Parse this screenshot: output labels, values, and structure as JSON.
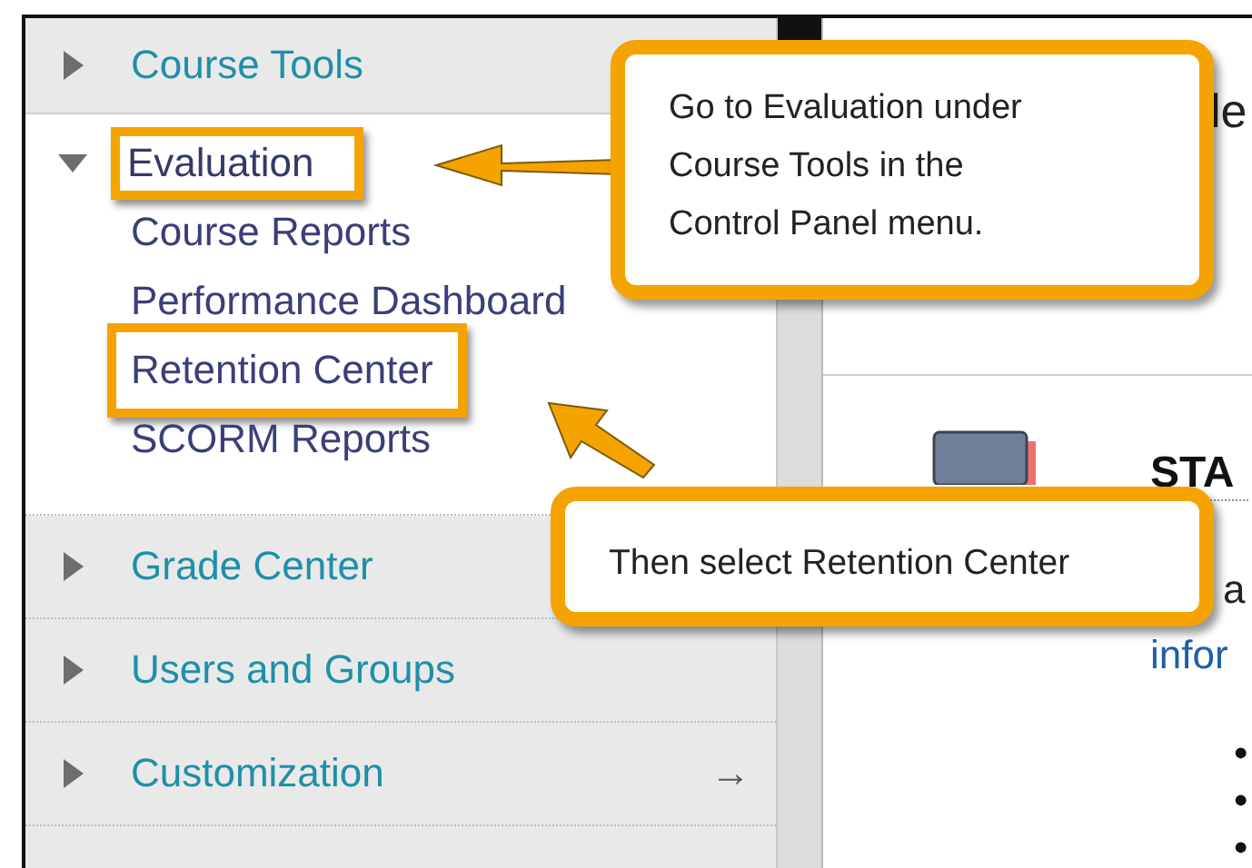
{
  "sidebar": {
    "items": [
      {
        "label": "Course Tools",
        "expanded": false,
        "highlighted": false
      },
      {
        "label": "Evaluation",
        "expanded": true,
        "highlighted": true,
        "children": [
          {
            "label": "Course Reports",
            "highlighted": false
          },
          {
            "label": "Performance Dashboard",
            "highlighted": false
          },
          {
            "label": "Retention Center",
            "highlighted": true
          },
          {
            "label": "SCORM Reports",
            "highlighted": false
          }
        ]
      },
      {
        "label": "Grade Center",
        "expanded": false,
        "highlighted": false
      },
      {
        "label": "Users and Groups",
        "expanded": false,
        "highlighted": false
      },
      {
        "label": "Customization",
        "expanded": false,
        "highlighted": false,
        "trailing": "→"
      }
    ]
  },
  "content": {
    "heading_fragment": "le",
    "title": "STA",
    "text_fragment": "a",
    "link_fragment": "infor",
    "bullets": [
      "•",
      "•",
      "•"
    ]
  },
  "callouts": [
    {
      "text": "Go to Evaluation under Course Tools in the Control Panel menu."
    },
    {
      "text": "Then select Retention Center"
    }
  ]
}
